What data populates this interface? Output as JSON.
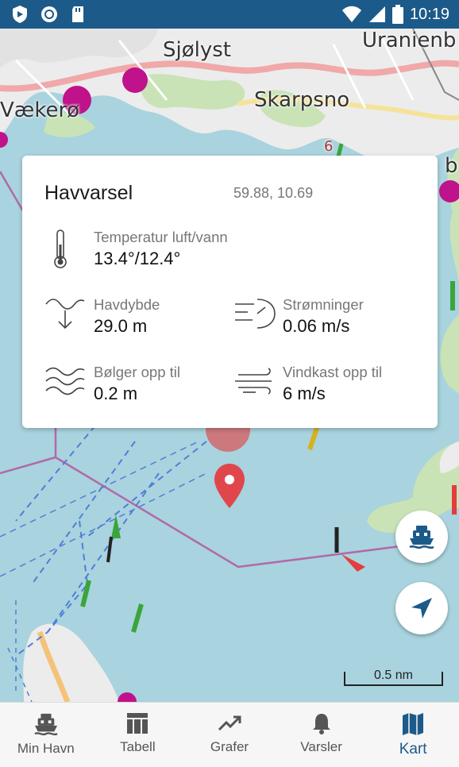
{
  "status_bar": {
    "time": "10:19"
  },
  "map": {
    "places": [
      "Sjølyst",
      "Uranienb",
      "Skarpsno",
      "Vækerø",
      "6",
      "b"
    ],
    "scale_label": "0.5 nm"
  },
  "forecast": {
    "title": "Havvarsel",
    "coords": "59.88, 10.69",
    "temperature": {
      "label": "Temperatur luft/vann",
      "value": "13.4°/12.4°"
    },
    "depth": {
      "label": "Havdybde",
      "value": "29.0 m"
    },
    "current": {
      "label": "Strømninger",
      "value": "0.06 m/s"
    },
    "waves": {
      "label": "Bølger opp til",
      "value": "0.2 m"
    },
    "gust": {
      "label": "Vindkast opp til",
      "value": "6 m/s"
    }
  },
  "nav": {
    "items": [
      {
        "label": "Min Havn",
        "icon": "ferry-icon"
      },
      {
        "label": "Tabell",
        "icon": "table-icon"
      },
      {
        "label": "Grafer",
        "icon": "trend-icon"
      },
      {
        "label": "Varsler",
        "icon": "bell-icon"
      },
      {
        "label": "Kart",
        "icon": "map-icon"
      }
    ],
    "active": "Kart"
  },
  "colors": {
    "primary": "#1c5a8a",
    "pin": "#e0474c",
    "water": "#a9d3de",
    "land": "#ececec",
    "park": "#c9e3b6"
  }
}
